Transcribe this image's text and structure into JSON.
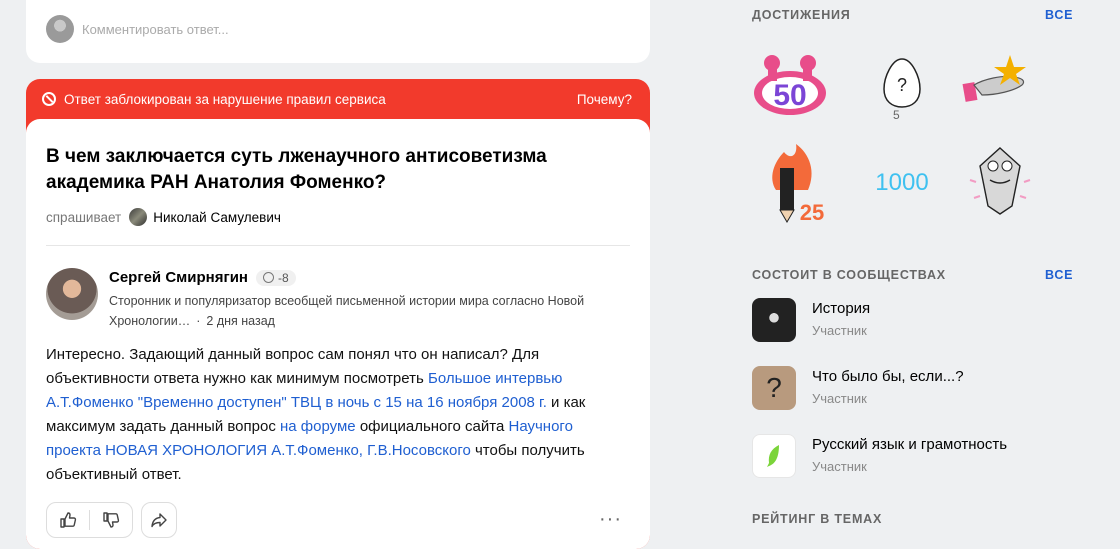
{
  "comment_card": {
    "placeholder": "Комментировать ответ..."
  },
  "blocked_banner": {
    "message": "Ответ заблокирован за нарушение правил сервиса",
    "why": "Почему?",
    "color": "#f23a2c"
  },
  "question": {
    "title": "В чем заключается суть лженаучного антисоветизма академика РАН Анатолия Фоменко?",
    "asks_label": "спрашивает",
    "asker": "Николай Самулевич"
  },
  "answer": {
    "author": "Сергей Смирнягин",
    "reputation": "-8",
    "bio": "Сторонник и популяризатор всеобщей письменной истории мира согласно Новой Хронологии…",
    "time": "2 дня назад",
    "text_1": "Интересно. Задающий данный вопрос сам понял что он написал? Для объективности ответа нужно как минимум посмотреть ",
    "link_1": "Большое интервью А.Т.Фоменко \"Временно доступен\" ТВЦ в ночь с 15 на 16 ноября 2008 г.",
    "text_2": " и как максимум задать данный вопрос ",
    "link_2": "на форуме",
    "text_3": " официального сайта ",
    "link_3": "Научного проекта НОВАЯ ХРОНОЛОГИЯ А.Т.Фоменко, Г.В.Носовского",
    "text_4": " чтобы получить объективный ответ.",
    "more": "···"
  },
  "achievements": {
    "title": "ДОСТИЖЕНИЯ",
    "all": "ВСЕ",
    "badge_50": "50",
    "badge_q": "?",
    "badge_q_count": "5",
    "badge_25": "25",
    "badge_1000": "1000"
  },
  "communities": {
    "title": "СОСТОИТ В СООБЩЕСТВАХ",
    "all": "ВСЕ",
    "items": [
      {
        "name": "История",
        "role": "Участник"
      },
      {
        "name": "Что было бы, если...?",
        "role": "Участник"
      },
      {
        "name": "Русский язык и грамотность",
        "role": "Участник"
      }
    ]
  },
  "rating": {
    "title": "РЕЙТИНГ В ТЕМАХ"
  }
}
